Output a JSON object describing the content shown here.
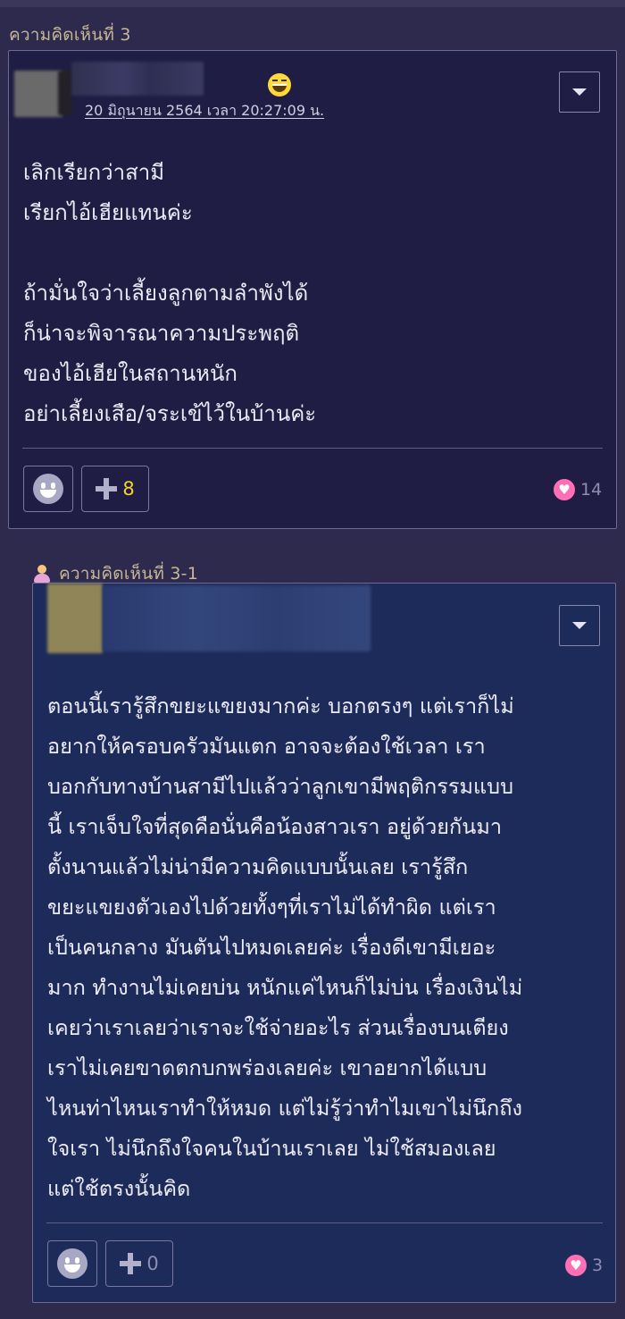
{
  "comment_1": {
    "label": "ความคิดเห็นที่ 3",
    "timestamp": "20 มิถุนายน 2564 เวลา 20:27:09 น.",
    "text": "เลิกเรียกว่าสามี\nเรียกไอ้เฮียแทนค่ะ\n\nถ้ามั่นใจว่าเลี้ยงลูกตามลำพังได้\nก็น่าจะพิจารณาความประพฤติ\nของไอ้เฮียในสถานหนัก\nอย่าเลี้ยงเสือ/จระเข้ไว้ในบ้านค่ะ",
    "plus_count": "8",
    "heart_count": "14"
  },
  "comment_2": {
    "label": "ความคิดเห็นที่ 3-1",
    "text": "ตอนนี้เรารู้สึกขยะแขยงมากค่ะ บอกตรงๆ แต่เราก็ไม่\nอยากให้ครอบครัวมันแตก อาจจะต้องใช้เวลา เรา\nบอกกับทางบ้านสามีไปแล้วว่าลูกเขามีพฤติกรรมแบบ\nนี้ เราเจ็บใจที่สุดคือนั่นคือน้องสาวเรา อยู่ด้วยกันมา\nตั้งนานแล้วไม่น่ามีความคิดแบบนั้นเลย เรารู้สึก\nขยะแขยงตัวเองไปด้วยทั้งๆที่เราไม่ได้ทำผิด แต่เรา\nเป็นคนกลาง มันตันไปหมดเลยค่ะ เรื่องดีเขามีเยอะ\nมาก ทำงานไม่เคยบ่น หนักแค่ไหนก็ไม่บ่น เรื่องเงินไม่\nเคยว่าเราเลยว่าเราจะใช้จ่ายอะไร ส่วนเรื่องบนเตียง\nเราไม่เคยขาดตกบกพร่องเลยค่ะ เขาอยากได้แบบ\nไหนท่าไหนเราทำให้หมด แต่ไม่รู้ว่าทำไมเขาไม่นึกถึง\nใจเรา ไม่นึกถึงใจคนในบ้านเราเลย ไม่ใช้สมองเลย\nแต่ใช้ตรงนั้นคิด",
    "plus_count": "0",
    "heart_count": "3"
  },
  "colors": {
    "background": "#2d2a4e",
    "card_1": "#1f1d43",
    "card_2": "#1d2b5a",
    "label": "#c6b795",
    "heart": "#ff6fb5",
    "plus_count_active": "#f5d229"
  },
  "icons": {
    "emotion": "smile-face-icon",
    "plus": "plus-icon",
    "heart": "heart-icon",
    "dropdown": "chevron-down-icon",
    "reply_user": "person-icon"
  }
}
